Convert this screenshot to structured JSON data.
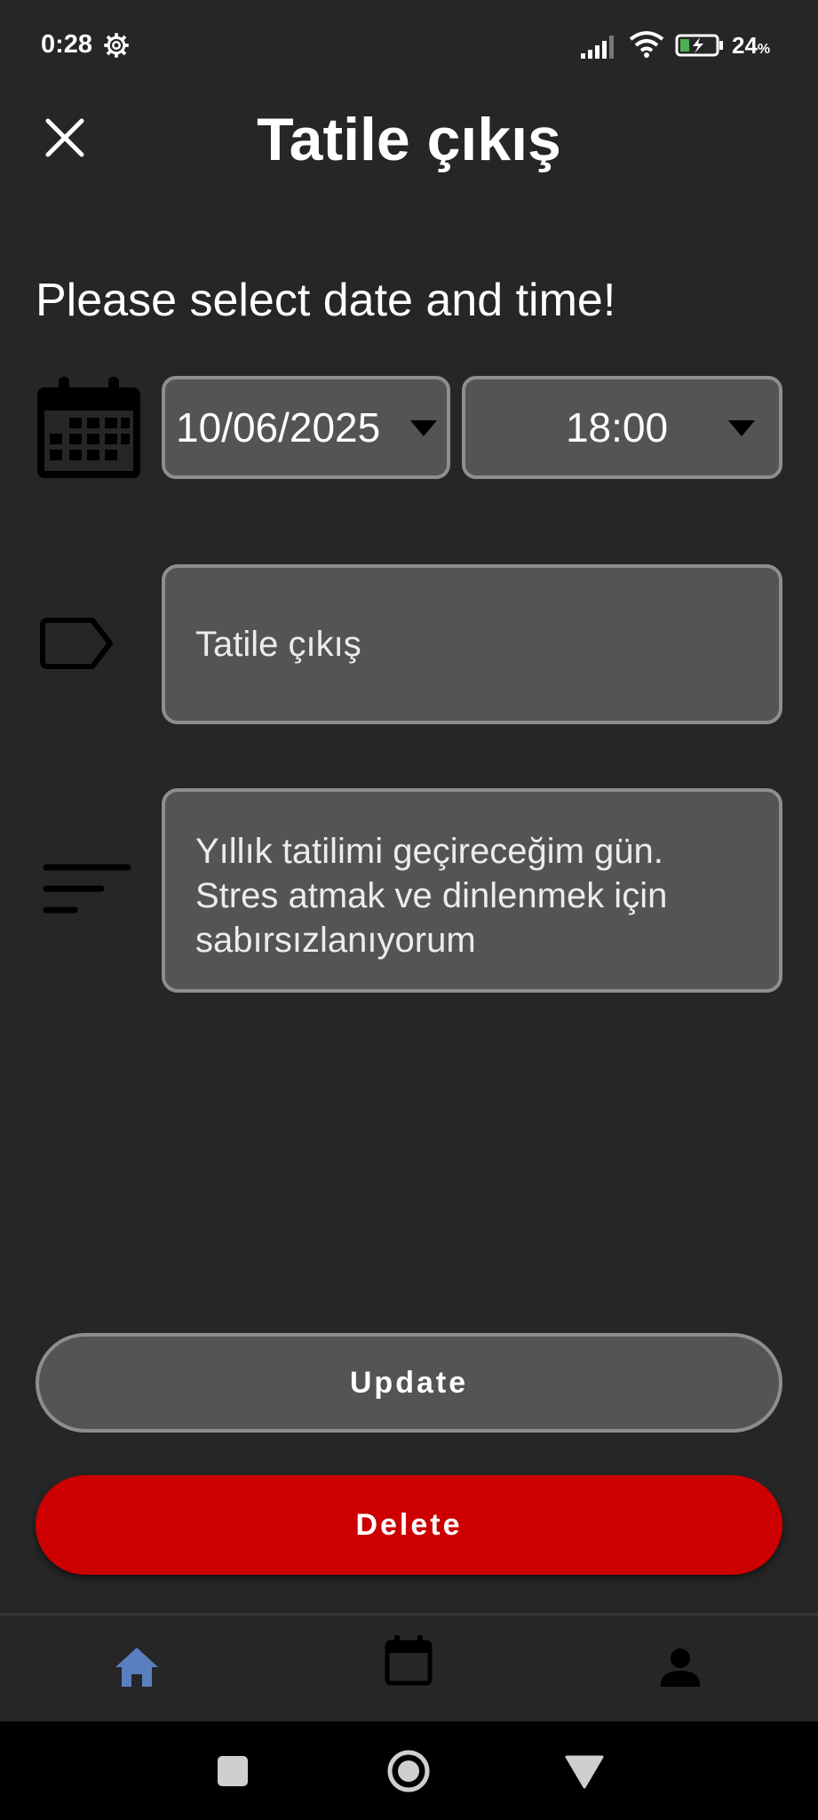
{
  "status_bar": {
    "time": "0:28",
    "battery_percent": "24",
    "battery_unit": "%",
    "icons": [
      "gear-icon",
      "signal-icon",
      "wifi-icon",
      "battery-charging-icon"
    ]
  },
  "header": {
    "title": "Tatile çıkış",
    "close_icon": "close-icon"
  },
  "prompt": "Please select date and time!",
  "schedule": {
    "date": "10/06/2025",
    "time": "18:00"
  },
  "form": {
    "title_value": "Tatile çıkış",
    "notes_value": "Yıllık tatilimi geçireceğim gün. Stres atmak ve dinlenmek için sabırsızlanıyorum"
  },
  "actions": {
    "update_label": "Update",
    "delete_label": "Delete"
  },
  "bottom_nav": {
    "items": [
      {
        "icon": "home-icon",
        "active": true
      },
      {
        "icon": "calendar-icon",
        "active": false
      },
      {
        "icon": "person-icon",
        "active": false
      }
    ]
  },
  "colors": {
    "background": "#262626",
    "field_fill": "#545454",
    "field_border": "#8e8e8e",
    "delete_red": "#cc0000",
    "nav_active": "#5a7fc0",
    "battery_green": "#4caf50"
  }
}
